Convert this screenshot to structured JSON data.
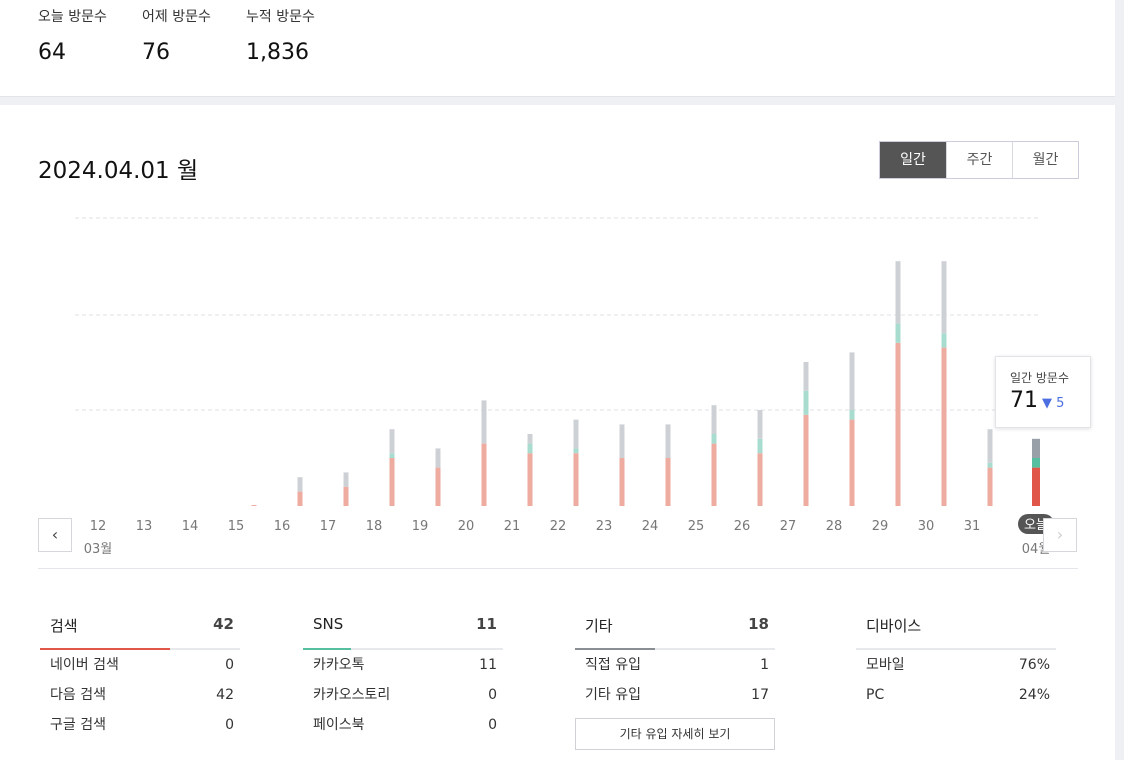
{
  "summary": {
    "today_label": "오늘 방문수",
    "today_value": "64",
    "yesterday_label": "어제 방문수",
    "yesterday_value": "76",
    "total_label": "누적 방문수",
    "total_value": "1,836"
  },
  "date_title": "2024.04.01 월",
  "period_tabs": [
    "일간",
    "주간",
    "월간"
  ],
  "active_tab": "일간",
  "nav": {
    "prev": "‹",
    "next": "›"
  },
  "tooltip": {
    "label": "일간 방문수",
    "value": "71",
    "delta": "▼ 5"
  },
  "colors": {
    "search": "#eeaba0",
    "sns": "#a8dccf",
    "other": "#cdd0d5",
    "today_search": "#e0574a",
    "today_sns": "#56bf9f",
    "today_other": "#9aa0a8"
  },
  "chart_data": {
    "type": "bar",
    "stacked": true,
    "categories": [
      "12",
      "13",
      "14",
      "15",
      "16",
      "17",
      "18",
      "19",
      "20",
      "21",
      "22",
      "23",
      "24",
      "25",
      "26",
      "27",
      "28",
      "29",
      "30",
      "31",
      "오늘"
    ],
    "month_labels": {
      "12": "03월",
      "오늘": "04월"
    },
    "series": [
      {
        "values": [
          0,
          0,
          0,
          0.2,
          3,
          4,
          10,
          8,
          13,
          11,
          11,
          10,
          10,
          13,
          11,
          19,
          18,
          34,
          33,
          8,
          8
        ]
      },
      {
        "values": [
          0,
          0,
          0,
          0,
          0,
          0,
          1,
          0,
          0,
          2,
          1,
          0,
          0,
          2,
          3,
          5,
          2,
          4,
          3,
          1,
          2
        ]
      },
      {
        "values": [
          0,
          0,
          0,
          0,
          3,
          3,
          5,
          4,
          9,
          2,
          6,
          7,
          7,
          6,
          6,
          6,
          12,
          13,
          15,
          7,
          4
        ]
      }
    ],
    "ylim": [
      0,
      60
    ],
    "grid": true,
    "highlight": "오늘"
  },
  "breakdown": {
    "search": {
      "title": "검색",
      "total": "42",
      "rows": [
        {
          "label": "네이버 검색",
          "value": "0"
        },
        {
          "label": "다음 검색",
          "value": "42"
        },
        {
          "label": "구글 검색",
          "value": "0"
        }
      ]
    },
    "sns": {
      "title": "SNS",
      "total": "11",
      "rows": [
        {
          "label": "카카오톡",
          "value": "11"
        },
        {
          "label": "카카오스토리",
          "value": "0"
        },
        {
          "label": "페이스북",
          "value": "0"
        }
      ]
    },
    "other": {
      "title": "기타",
      "total": "18",
      "rows": [
        {
          "label": "직접 유입",
          "value": "1"
        },
        {
          "label": "기타 유입",
          "value": "17"
        }
      ],
      "detail_button": "기타 유입 자세히 보기"
    },
    "device": {
      "title": "디바이스",
      "rows": [
        {
          "label": "모바일",
          "value": "76%"
        },
        {
          "label": "PC",
          "value": "24%"
        }
      ]
    }
  }
}
